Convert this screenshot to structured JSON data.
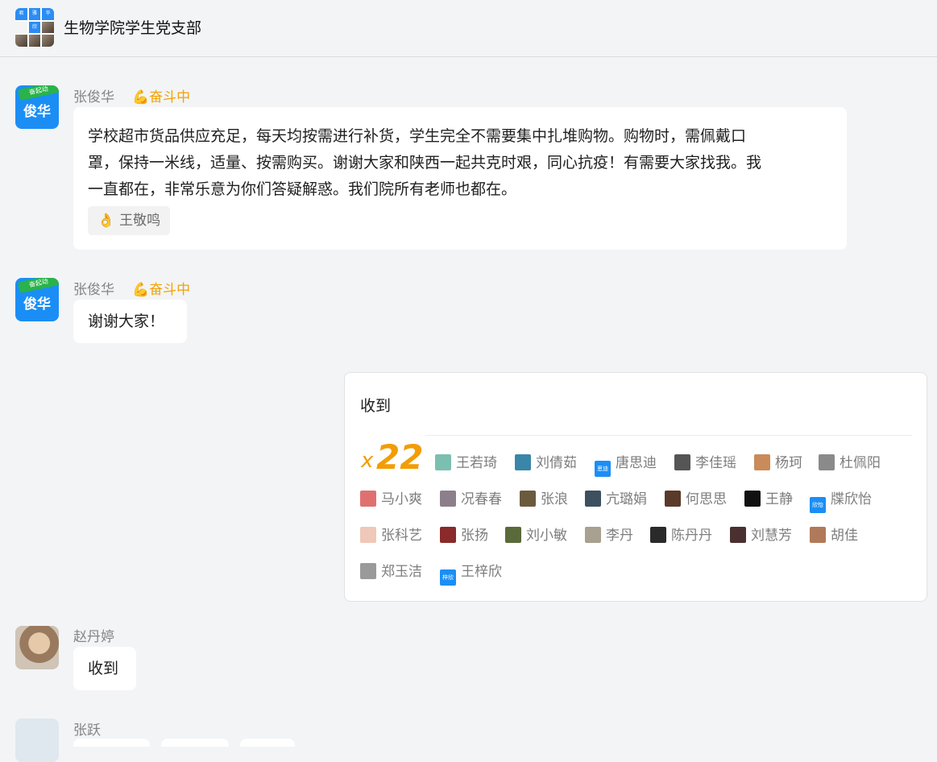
{
  "header": {
    "title": "生物学院学生党支部",
    "group_avatar_cells": [
      "君",
      "雅",
      "华",
      "",
      "欣",
      "",
      "",
      "",
      ""
    ]
  },
  "messages": [
    {
      "sender": "张俊华",
      "status": "💪奋斗中",
      "avatar_text": "俊华",
      "avatar_tag": "奋起动",
      "lines": [
        "学校超市货品供应充足，每天均按需进行补货，学生完全不需要集中扎堆购物。购物时，需佩戴口",
        "罩，保持一米线，适量、按需购买。谢谢大家和陕西一起共克时艰，同心抗疫！有需要大家找我。我",
        "一直都在，非常乐意为你们答疑解惑。我们院所有老师也都在。"
      ],
      "reaction_icon": "👌",
      "reaction_user": "王敬鸣"
    },
    {
      "sender": "张俊华",
      "status": "💪奋斗中",
      "avatar_text": "俊华",
      "avatar_tag": "奋起动",
      "text": "谢谢大家！"
    },
    {
      "sender": "赵丹婷",
      "text": "收到"
    },
    {
      "sender": "张跃"
    }
  ],
  "ack_card": {
    "text": "收到",
    "x_label": "x",
    "count": "22",
    "people": [
      {
        "name": "王若琦",
        "color": "#7bbfb0"
      },
      {
        "name": "刘倩茹",
        "color": "#3a86a8"
      },
      {
        "name": "唐思迪",
        "color": "#1b8ef5",
        "ico_text": "思迪"
      },
      {
        "name": "李佳瑶",
        "color": "#555555"
      },
      {
        "name": "杨珂",
        "color": "#c98b5a"
      },
      {
        "name": "杜佩阳",
        "color": "#8a8a8a"
      },
      {
        "name": "马小爽",
        "color": "#e07070"
      },
      {
        "name": "况春春",
        "color": "#8c7f8a"
      },
      {
        "name": "张浪",
        "color": "#6b5a3e"
      },
      {
        "name": "亢璐娟",
        "color": "#3c5060"
      },
      {
        "name": "何思思",
        "color": "#5a3a2a"
      },
      {
        "name": "王静",
        "color": "#111111"
      },
      {
        "name": "牒欣怡",
        "color": "#1b8ef5",
        "ico_text": "欣怡"
      },
      {
        "name": "张科艺",
        "color": "#efc8b8"
      },
      {
        "name": "张扬",
        "color": "#8a2a2a"
      },
      {
        "name": "刘小敏",
        "color": "#5a6a3a"
      },
      {
        "name": "李丹",
        "color": "#a8a090"
      },
      {
        "name": "陈丹丹",
        "color": "#2a2a2a"
      },
      {
        "name": "刘慧芳",
        "color": "#4a3030"
      },
      {
        "name": "胡佳",
        "color": "#b07a5a"
      },
      {
        "name": "郑玉洁",
        "color": "#9a9a9a"
      },
      {
        "name": "王梓欣",
        "color": "#1b8ef5",
        "ico_text": "梓欣"
      }
    ]
  },
  "colors": {
    "background": "#f3f4f6",
    "accent_count": "#f29d06",
    "avatar_blue": "#1b8ef5"
  }
}
